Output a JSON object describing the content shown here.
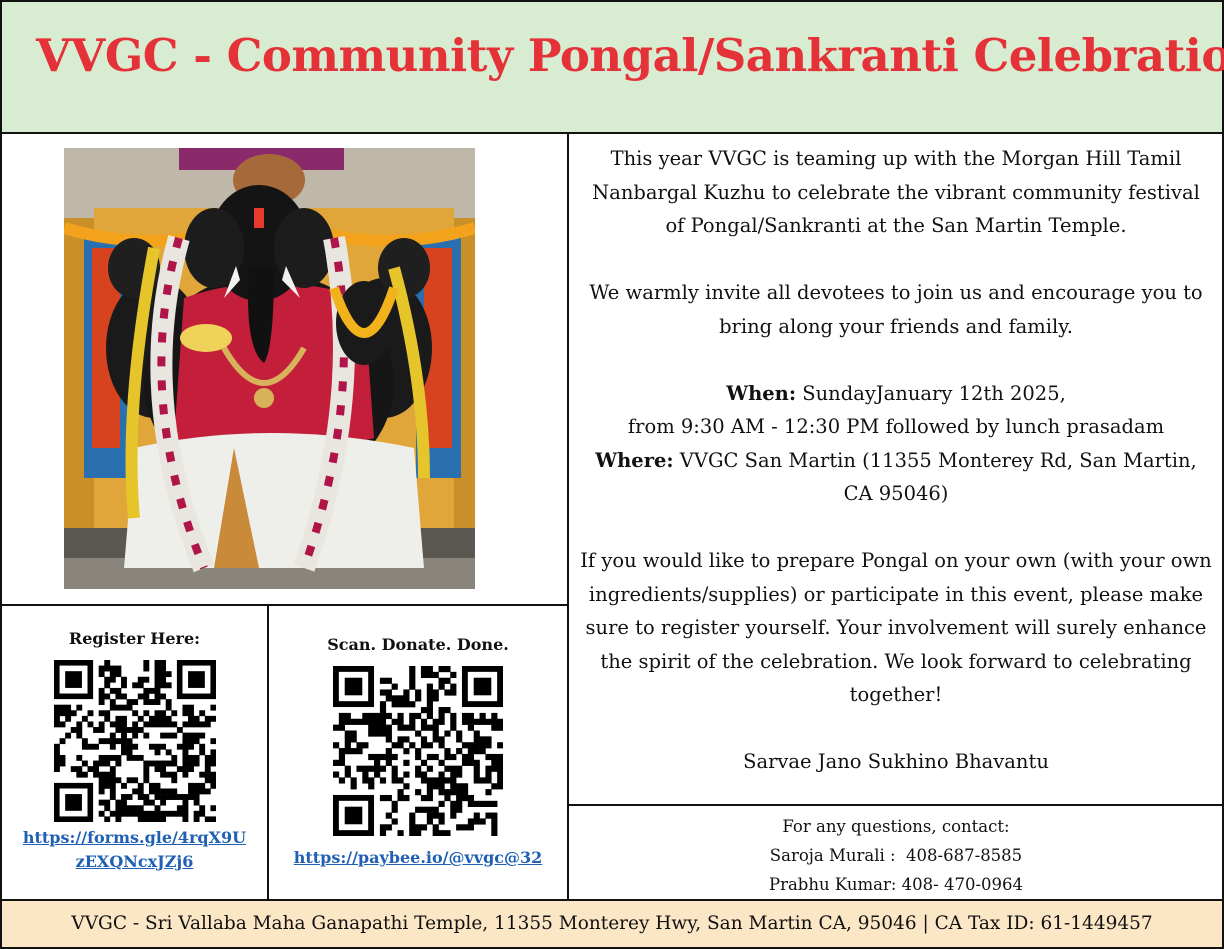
{
  "header": {
    "title": "VVGC - Community Pongal/Sankranti Celebration"
  },
  "colors": {
    "title_red": "#e53238",
    "header_bg": "#d7ecd0",
    "footer_bg": "#fbe6c6",
    "link_blue": "#1f5fb4"
  },
  "photo": {
    "subject": "ganesha-deity-with-garlands"
  },
  "register": {
    "label": "Register Here:",
    "link_line1": "https://forms.gle/4rqX9U",
    "link_line2": "zEXQNcxJZj6",
    "icon": "qr-code-icon"
  },
  "donate": {
    "label": "Scan. Donate. Done.",
    "link": "https://paybee.io/@vvgc@32",
    "icon": "qr-code-icon"
  },
  "body": {
    "intro": "This year VVGC is teaming up with the Morgan Hill Tamil Nanbargal Kuzhu to celebrate the vibrant community festival of Pongal/Sankranti at the San Martin Temple.",
    "invite": "We warmly invite all devotees to join us and encourage you to bring along your friends and family.",
    "when_label": "When:",
    "when_value": " SundayJanuary 12th 2025,",
    "time_line": "from 9:30 AM - 12:30 PM followed by lunch prasadam",
    "where_label": "Where:",
    "where_value": " VVGC San Martin (11355 Monterey Rd, San Martin, CA 95046)",
    "register_note": "If you would like to prepare Pongal on your own (with your own ingredients/supplies) or participate in this event, please make sure to register yourself. Your involvement will surely enhance the spirit of the celebration. We look forward to celebrating together!",
    "blessing": "Sarvae Jano Sukhino Bhavantu"
  },
  "contact": {
    "heading": "For any questions, contact:",
    "person1": "Saroja Murali :  408-687-8585",
    "person2": "Prabhu Kumar: 408- 470-0964"
  },
  "footer": {
    "text": "VVGC - Sri Vallaba Maha Ganapathi Temple, 11355 Monterey Hwy, San Martin CA, 95046 | CA Tax ID: 61-1449457"
  }
}
